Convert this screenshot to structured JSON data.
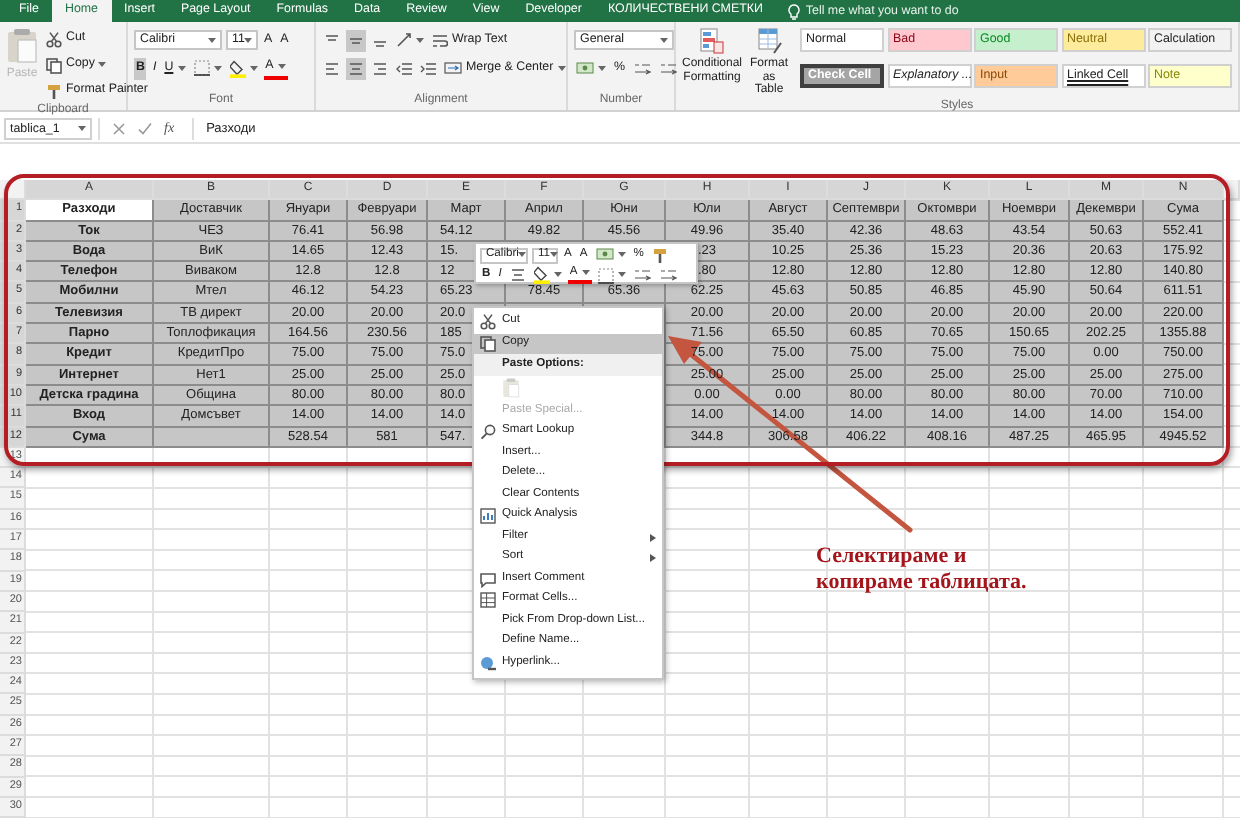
{
  "ribbon_tabs": [
    {
      "label": "File",
      "selected": false
    },
    {
      "label": "Home",
      "selected": true
    },
    {
      "label": "Insert",
      "selected": false
    },
    {
      "label": "Page Layout",
      "selected": false
    },
    {
      "label": "Formulas",
      "selected": false
    },
    {
      "label": "Data",
      "selected": false
    },
    {
      "label": "Review",
      "selected": false
    },
    {
      "label": "View",
      "selected": false
    },
    {
      "label": "Developer",
      "selected": false
    },
    {
      "label": "КОЛИЧЕСТВЕНИ СМЕТКИ",
      "selected": false
    }
  ],
  "tell_me": "Tell me what you want to do",
  "ribbon": {
    "clipboard": {
      "paste": {
        "label": "Paste",
        "disabled": true
      },
      "cut": "Cut",
      "copy": "Copy",
      "format_painter": "Format Painter",
      "label": "Clipboard"
    },
    "font": {
      "name": "Calibri",
      "size": "11",
      "grow": "A",
      "shrink": "A",
      "bold": {
        "label": "B",
        "on": true
      },
      "italic": "I",
      "underline": "U",
      "color_button": "A",
      "label": "Font"
    },
    "alignment": {
      "middle_on": true,
      "center_on": true,
      "wrap_text": "Wrap Text",
      "merge": "Merge & Center",
      "label": "Alignment"
    },
    "number": {
      "format": "General",
      "percent": "%",
      "label": "Number"
    },
    "styles": {
      "conditional": "Conditional Formatting",
      "format_table": "Format as Table",
      "label": "Styles",
      "cells": [
        {
          "label": "Normal",
          "kind": "plain",
          "color": "#ffffff"
        },
        {
          "label": "Bad",
          "kind": "plain",
          "color": "#ffc7ce"
        },
        {
          "label": "Good",
          "kind": "plain",
          "color": "#c6efce"
        },
        {
          "label": "Neutral",
          "kind": "plain",
          "color": "#ffeb9c"
        },
        {
          "label": "Calculation",
          "kind": "plain",
          "color": "#f2f2f2"
        },
        {
          "label": "Check Cell",
          "kind": "boxed",
          "color": "#a5a5a5"
        },
        {
          "label": "Explanatory ...",
          "kind": "italic",
          "color": "#ffffff"
        },
        {
          "label": "Input",
          "kind": "plain",
          "color": "#ffcc99"
        },
        {
          "label": "Linked Cell",
          "kind": "underlined",
          "color": "#ffffff"
        },
        {
          "label": "Note",
          "kind": "plain",
          "color": "#ffffcc"
        }
      ]
    }
  },
  "formula_bar": {
    "name_box": "tablica_1",
    "function_label": "fx",
    "content": "Разходи"
  },
  "sheet": {
    "columns": [
      "A",
      "B",
      "C",
      "D",
      "E",
      "F",
      "G",
      "H",
      "I",
      "J",
      "K",
      "L",
      "M",
      "N"
    ],
    "row_numbers": [
      "1",
      "2",
      "3",
      "4",
      "5",
      "6",
      "7",
      "8",
      "9",
      "10",
      "11",
      "12",
      "13",
      "14",
      "15",
      "16",
      "17",
      "18",
      "19",
      "20",
      "21",
      "22",
      "23",
      "24",
      "25",
      "26",
      "27",
      "28",
      "29",
      "30"
    ],
    "rows": [
      [
        "Разходи",
        "Доставчик",
        "Януари",
        "Февруари",
        "Март",
        "Април",
        "Юни",
        "Юли",
        "Август",
        "Септември",
        "Октомври",
        "Ноември",
        "Декември",
        "Сума"
      ],
      [
        "Ток",
        "ЧЕЗ",
        "76.41",
        "56.98",
        "54.12",
        "49.82",
        "45.56",
        "49.96",
        "35.40",
        "42.36",
        "48.63",
        "43.54",
        "50.63",
        "552.41"
      ],
      [
        "Вода",
        "ВиК",
        "14.65",
        "12.43",
        "15.",
        null,
        null,
        ".23",
        "10.25",
        "25.36",
        "15.23",
        "20.36",
        "20.63",
        "175.92"
      ],
      [
        "Телефон",
        "Виваком",
        "12.8",
        "12.8",
        "12",
        null,
        null,
        ".80",
        "12.80",
        "12.80",
        "12.80",
        "12.80",
        "12.80",
        "140.80"
      ],
      [
        "Мобилни",
        "Мтел",
        "46.12",
        "54.23",
        "65.23",
        "78.45",
        "65.36",
        "62.25",
        "45.63",
        "50.85",
        "46.85",
        "45.90",
        "50.64",
        "611.51"
      ],
      [
        "Телевизия",
        "ТВ директ",
        "20.00",
        "20.00",
        "20.0",
        null,
        null,
        "20.00",
        "20.00",
        "20.00",
        "20.00",
        "20.00",
        "20.00",
        "220.00"
      ],
      [
        "Парно",
        "Топлофикация",
        "164.56",
        "230.56",
        "185",
        null,
        null,
        "71.56",
        "65.50",
        "60.85",
        "70.65",
        "150.65",
        "202.25",
        "1355.88"
      ],
      [
        "Кредит",
        "КредитПро",
        "75.00",
        "75.00",
        "75.0",
        null,
        null,
        "75.00",
        "75.00",
        "75.00",
        "75.00",
        "75.00",
        "0.00",
        "750.00"
      ],
      [
        "Интернет",
        "Нет1",
        "25.00",
        "25.00",
        "25.0",
        null,
        null,
        "25.00",
        "25.00",
        "25.00",
        "25.00",
        "25.00",
        "25.00",
        "275.00"
      ],
      [
        "Детска градина",
        "Община",
        "80.00",
        "80.00",
        "80.0",
        null,
        null,
        "0.00",
        "0.00",
        "80.00",
        "80.00",
        "80.00",
        "70.00",
        "710.00"
      ],
      [
        "Вход",
        "Домсъвет",
        "14.00",
        "14.00",
        "14.0",
        null,
        null,
        "14.00",
        "14.00",
        "14.00",
        "14.00",
        "14.00",
        "14.00",
        "154.00"
      ],
      [
        "Сума",
        null,
        "528.54",
        "581",
        "547.",
        null,
        null,
        "344.8",
        "306.58",
        "406.22",
        "408.16",
        "487.25",
        "465.95",
        "4945.52"
      ]
    ]
  },
  "mini_toolbar": {
    "font": "Calibri",
    "size": "11",
    "grow": "A",
    "shrink": "A",
    "percent": "%",
    "bold": "B",
    "italic": "I",
    "color_button": "A"
  },
  "context_menu": [
    {
      "kind": "cut",
      "label": "Cut",
      "selected": false,
      "disabled": false,
      "submenu": false
    },
    {
      "kind": "copy",
      "label": "Copy",
      "selected": true,
      "disabled": false,
      "submenu": false
    },
    {
      "kind": "header",
      "label": "Paste Options:",
      "selected": false,
      "disabled": false,
      "submenu": false
    },
    {
      "kind": "paste",
      "selected": false,
      "disabled": true,
      "submenu": false
    },
    {
      "kind": "plain",
      "label": "Paste Special...",
      "selected": false,
      "disabled": true,
      "submenu": false
    },
    {
      "kind": "lookup",
      "label": "Smart Lookup",
      "selected": false,
      "disabled": false,
      "submenu": false
    },
    {
      "kind": "plain",
      "label": "Insert...",
      "selected": false,
      "disabled": false,
      "submenu": false
    },
    {
      "kind": "plain",
      "label": "Delete...",
      "selected": false,
      "disabled": false,
      "submenu": false
    },
    {
      "kind": "plain",
      "label": "Clear Contents",
      "selected": false,
      "disabled": false,
      "submenu": false
    },
    {
      "kind": "analysis",
      "label": "Quick Analysis",
      "selected": false,
      "disabled": false,
      "submenu": false
    },
    {
      "kind": "plain",
      "label": "Filter",
      "selected": false,
      "disabled": false,
      "submenu": true
    },
    {
      "kind": "plain",
      "label": "Sort",
      "selected": false,
      "disabled": false,
      "submenu": true
    },
    {
      "kind": "comment",
      "label": "Insert Comment",
      "selected": false,
      "disabled": false,
      "submenu": false
    },
    {
      "kind": "format",
      "label": "Format Cells...",
      "selected": false,
      "disabled": false,
      "submenu": false
    },
    {
      "kind": "plain",
      "label": "Pick From Drop-down List...",
      "selected": false,
      "disabled": false,
      "submenu": false
    },
    {
      "kind": "plain",
      "label": "Define Name...",
      "selected": false,
      "disabled": false,
      "submenu": false
    },
    {
      "kind": "link",
      "label": "Hyperlink...",
      "selected": false,
      "disabled": false,
      "submenu": false
    }
  ],
  "annotation": {
    "text": "Селектираме и копираме таблицата."
  }
}
